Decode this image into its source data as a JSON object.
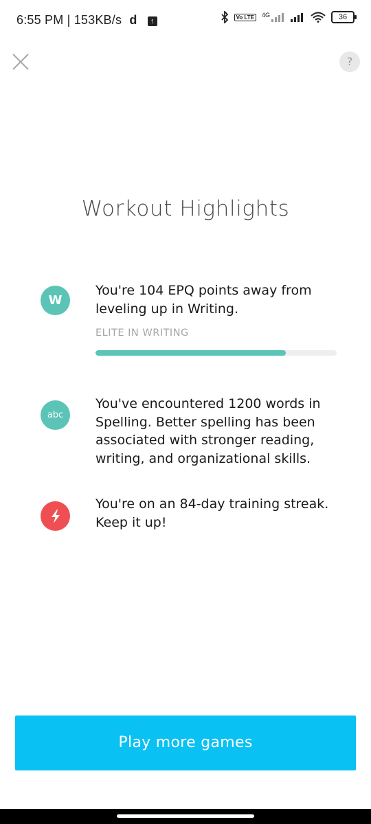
{
  "status_bar": {
    "time": "6:55 PM",
    "speed": "153KB/s",
    "net_type": "4G",
    "volte": "Vo LTE",
    "battery": "36"
  },
  "header": {
    "close_icon": "close-icon",
    "help_label": "?"
  },
  "page": {
    "title": "Workout Highlights"
  },
  "highlights": [
    {
      "icon_label": "W",
      "text": "You're 104 EPQ points away from leveling up in Writing.",
      "level_label": "ELITE IN WRITING",
      "progress": 0.79,
      "color": "#5bc4b7"
    },
    {
      "icon_label": "abc",
      "text": "You've encountered 1200 words in Spelling. Better spelling has been associated with stronger reading, writing, and organizational skills.",
      "color": "#5bc4b7"
    },
    {
      "icon": "lightning-icon",
      "text": "You're on an 84-day training streak. Keep it up!",
      "color": "#ef4f52"
    }
  ],
  "cta": {
    "label": "Play more games",
    "color": "#09c1f2"
  }
}
